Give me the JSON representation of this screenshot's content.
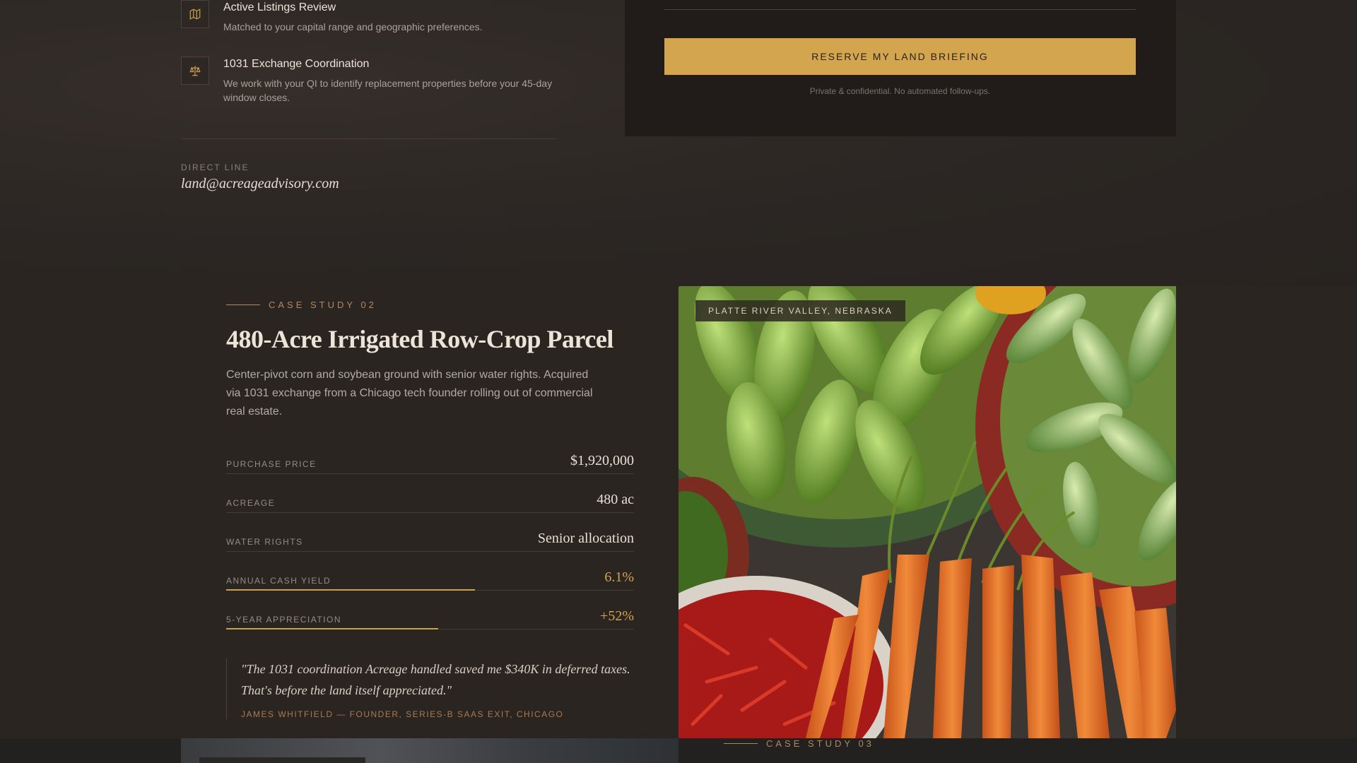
{
  "services": [
    {
      "icon": "map-icon",
      "title": "Active Listings Review",
      "description": "Matched to your capital range and geographic preferences."
    },
    {
      "icon": "scales-icon",
      "title": "1031 Exchange Coordination",
      "description": "We work with your QI to identify replacement properties before your 45-day window closes."
    }
  ],
  "direct_line": {
    "label": "DIRECT LINE",
    "email": "land@acreageadvisory.com"
  },
  "form": {
    "button_label": "RESERVE MY LAND BRIEFING",
    "note": "Private & confidential. No automated follow-ups."
  },
  "case_study": {
    "eyebrow": "CASE STUDY 02",
    "title": "480-Acre Irrigated Row-Crop Parcel",
    "description": "Center-pivot corn and soybean ground with senior water rights. Acquired via 1031 exchange from a Chicago tech founder rolling out of commercial real estate.",
    "stats": [
      {
        "label": "PURCHASE PRICE",
        "value": "$1,920,000"
      },
      {
        "label": "ACREAGE",
        "value": "480 ac"
      },
      {
        "label": "WATER RIGHTS",
        "value": "Senior allocation"
      },
      {
        "label": "ANNUAL CASH YIELD",
        "value": "6.1%",
        "bar_fill": 0.61
      },
      {
        "label": "5-YEAR APPRECIATION",
        "value": "+52%",
        "bar_fill": 0.52
      }
    ],
    "quote": "\"The 1031 coordination Acreage handled saved me $340K in deferred taxes. That's before the land itself appreciated.\"",
    "attribution": "JAMES WHITFIELD — FOUNDER, SERIES-B SAAS EXIT, CHICAGO",
    "photo_tag": "PLATTE RIVER VALLEY, NEBRASKA"
  },
  "next_case": {
    "eyebrow": "CASE STUDY 03"
  },
  "colors": {
    "accent": "#d2a54e",
    "background": "#2b2522",
    "card": "#211c1a"
  }
}
